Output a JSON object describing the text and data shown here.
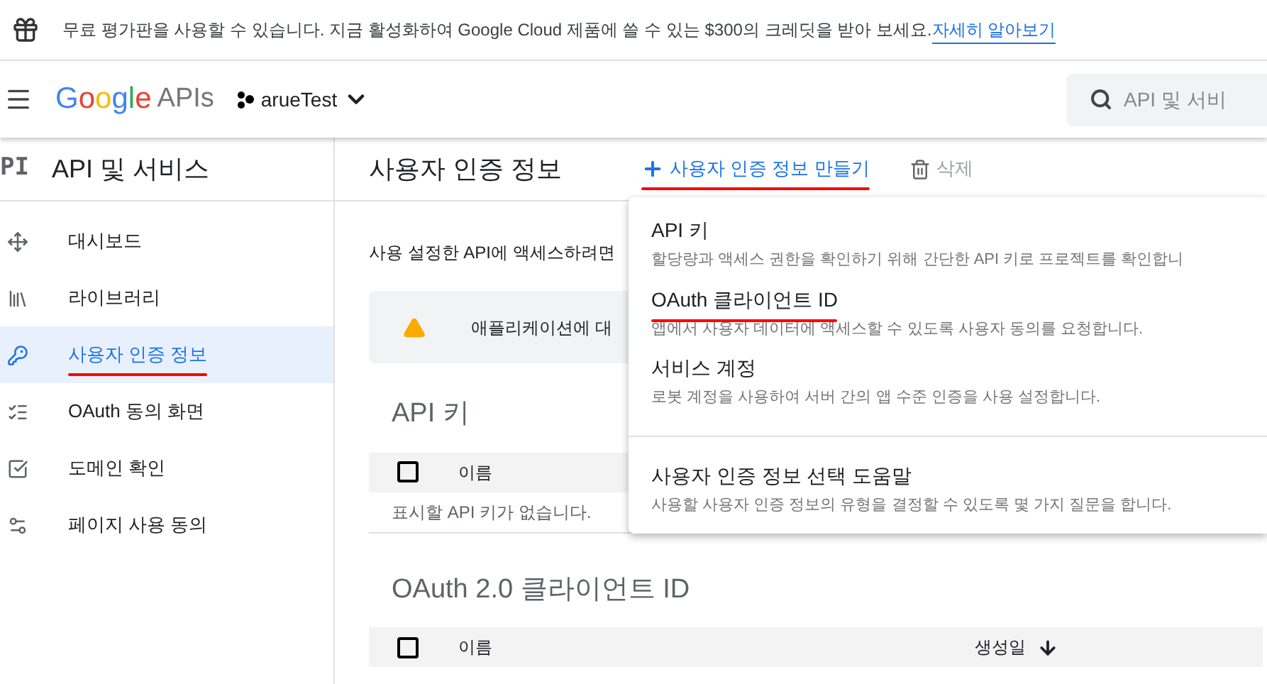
{
  "banner": {
    "text": "무료 평가판을 사용할 수 있습니다. 지금 활성화하여 Google Cloud 제품에 쓸 수 있는 $300의 크레딧을 받아 보세요.",
    "link": "자세히 알아보기"
  },
  "header": {
    "logo_google": "Google",
    "logo_apis": "APIs",
    "project": "arueTest",
    "search": {
      "placeholder": "API 및 서비"
    }
  },
  "sidebar": {
    "badge": "PI",
    "title": "API 및 서비스",
    "items": [
      {
        "kind": "dashboard",
        "label": "대시보드",
        "selected": false,
        "underlined": false
      },
      {
        "kind": "library",
        "label": "라이브러리",
        "selected": false,
        "underlined": false
      },
      {
        "kind": "key",
        "label": "사용자 인증 정보",
        "selected": true,
        "underlined": true
      },
      {
        "kind": "consent",
        "label": "OAuth 동의 화면",
        "selected": false,
        "underlined": false
      },
      {
        "kind": "domain",
        "label": "도메인 확인",
        "selected": false,
        "underlined": false
      },
      {
        "kind": "settings",
        "label": "페이지 사용 동의",
        "selected": false,
        "underlined": false
      }
    ]
  },
  "main": {
    "title": "사용자 인증 정보",
    "create_button": {
      "label": "사용자 인증 정보 만들기",
      "underlined": true
    },
    "delete_button": "삭제",
    "intro": "사용 설정한 API에 액세스하려면",
    "notice": "애플리케이션에 대",
    "api_keys": {
      "title": "API 키",
      "select_all": {
        "checked": false
      },
      "columns": [
        "이름"
      ],
      "empty": "표시할 API 키가 없습니다."
    },
    "oauth": {
      "title": "OAuth 2.0 클라이언트 ID",
      "select_all": {
        "checked": false
      },
      "columns": [
        "이름",
        "생성일"
      ]
    }
  },
  "menu": {
    "items": [
      {
        "title": "API 키",
        "description": "할당량과 액세스 권한을 확인하기 위해 간단한 API 키로 프로젝트를 확인합니",
        "underlined": false
      },
      {
        "title": "OAuth 클라이언트 ID",
        "description": "앱에서 사용자 데이터에 액세스할 수 있도록 사용자 동의를 요청합니다.",
        "underlined": true
      },
      {
        "title": "서비스 계정",
        "description": "로봇 계정을 사용하여 서버 간의 앱 수준 인증을 사용 설정합니다.",
        "underlined": false
      },
      {
        "title": "사용자 인증 정보 선택 도움말",
        "description": "사용할 사용자 인증 정보의 유형을 결정할 수 있도록 몇 가지 질문을 합니다.",
        "underlined": false,
        "divider_before": true
      }
    ]
  }
}
